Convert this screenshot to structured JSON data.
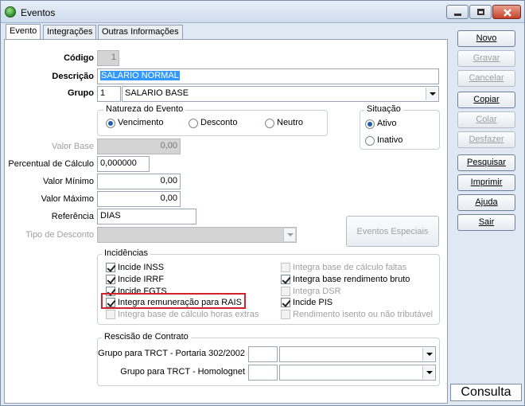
{
  "window": {
    "title": "Eventos"
  },
  "tabs": [
    "Evento",
    "Integrações",
    "Outras Informações"
  ],
  "form": {
    "codigo_label": "Código",
    "codigo_value": "1",
    "descricao_label": "Descrição",
    "descricao_value": "SALARIO NORMAL",
    "grupo_label": "Grupo",
    "grupo_code": "1",
    "grupo_name": "SALARIO BASE",
    "valor_base_label": "Valor Base",
    "valor_base_value": "0,00",
    "percentual_label": "Percentual de Cálculo",
    "percentual_value": "0,000000",
    "valor_minimo_label": "Valor Mínimo",
    "valor_minimo_value": "0,00",
    "valor_maximo_label": "Valor Máximo",
    "valor_maximo_value": "0,00",
    "referencia_label": "Referência",
    "referencia_value": "DIAS",
    "tipo_desconto_label": "Tipo de Desconto",
    "eventos_especiais_label": "Eventos Especiais"
  },
  "natureza": {
    "title": "Natureza do Evento",
    "options": [
      "Vencimento",
      "Desconto",
      "Neutro"
    ],
    "selected": "Vencimento"
  },
  "situacao": {
    "title": "Situação",
    "options": [
      "Ativo",
      "Inativo"
    ],
    "selected": "Ativo"
  },
  "incidencias": {
    "title": "Incidências",
    "left": [
      {
        "label": "Incide INSS",
        "checked": true,
        "enabled": true
      },
      {
        "label": "Incide IRRF",
        "checked": true,
        "enabled": true
      },
      {
        "label": "Incide FGTS",
        "checked": true,
        "enabled": true
      },
      {
        "label": "Integra remuneração para RAIS",
        "checked": true,
        "enabled": true
      },
      {
        "label": "Integra base de cálculo horas extras",
        "checked": false,
        "enabled": false
      }
    ],
    "right": [
      {
        "label": "Integra base de cálculo faltas",
        "checked": false,
        "enabled": false
      },
      {
        "label": "Integra base rendimento bruto",
        "checked": true,
        "enabled": true
      },
      {
        "label": "Integra DSR",
        "checked": false,
        "enabled": false
      },
      {
        "label": "Incide PIS",
        "checked": true,
        "enabled": true
      },
      {
        "label": "Rendimento isento ou não tributável",
        "checked": false,
        "enabled": false
      }
    ]
  },
  "rescisao": {
    "title": "Rescisão de Contrato",
    "row1_label": "Grupo para TRCT - Portaria 302/2002",
    "row2_label": "Grupo para TRCT - Homolognet"
  },
  "buttons": [
    {
      "label": "Novo",
      "enabled": true
    },
    {
      "label": "Gravar",
      "enabled": false
    },
    {
      "label": "Cancelar",
      "enabled": false
    },
    {
      "label": "Copiar",
      "enabled": true
    },
    {
      "label": "Colar",
      "enabled": false
    },
    {
      "label": "Desfazer",
      "enabled": false
    },
    {
      "label": "Pesquisar",
      "enabled": true
    },
    {
      "label": "Imprimir",
      "enabled": true
    },
    {
      "label": "Ajuda",
      "enabled": true
    },
    {
      "label": "Sair",
      "enabled": true
    }
  ],
  "status": "Consulta",
  "colors": {
    "highlight": "#d2232a",
    "selection": "#3399ff"
  }
}
